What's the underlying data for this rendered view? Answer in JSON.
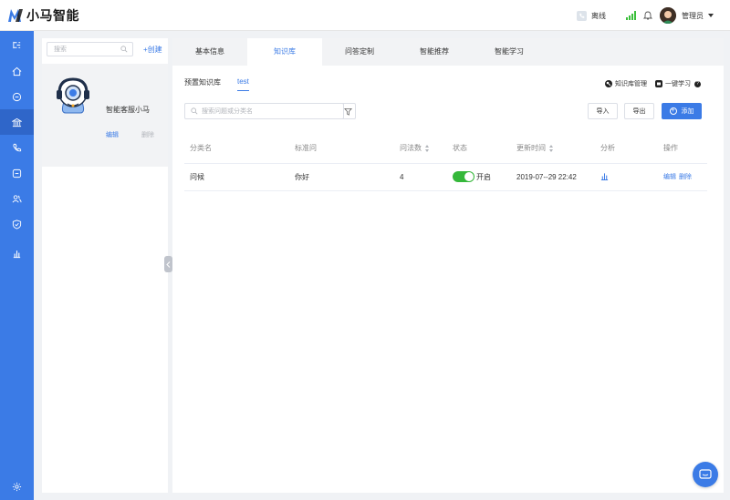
{
  "app": {
    "logo_text": "小马智能",
    "brand_color": "#3b7be6"
  },
  "header": {
    "status_text": "离线",
    "admin_name": "管理员"
  },
  "bot_panel": {
    "search_placeholder": "搜索",
    "create_label": "+创建",
    "bot": {
      "name": "智能客服小马",
      "edit_label": "编辑",
      "delete_label": "删除"
    }
  },
  "tabs": [
    {
      "label": "基本信息",
      "active": false
    },
    {
      "label": "知识库",
      "active": true
    },
    {
      "label": "问答定制",
      "active": false
    },
    {
      "label": "智能推荐",
      "active": false
    },
    {
      "label": "智能学习",
      "active": false
    }
  ],
  "subtabs": [
    {
      "label": "预置知识库",
      "active": false
    },
    {
      "label": "test",
      "active": true
    }
  ],
  "actions": {
    "kb_manage_label": "知识库管理",
    "one_click_learn_label": "一键学习",
    "search_placeholder": "搜索问题或分类名",
    "import_label": "导入",
    "export_label": "导出",
    "add_label": "添加"
  },
  "table": {
    "columns": [
      "分类名",
      "标准问",
      "问法数",
      "状态",
      "更新时间",
      "分析",
      "操作"
    ],
    "rows": [
      {
        "category": "问候",
        "standard_question": "你好",
        "count": "4",
        "status_label": "开启",
        "status_on": true,
        "updated": "2019-07--29 22:42",
        "edit_label": "编辑",
        "delete_label": "删除"
      }
    ]
  }
}
